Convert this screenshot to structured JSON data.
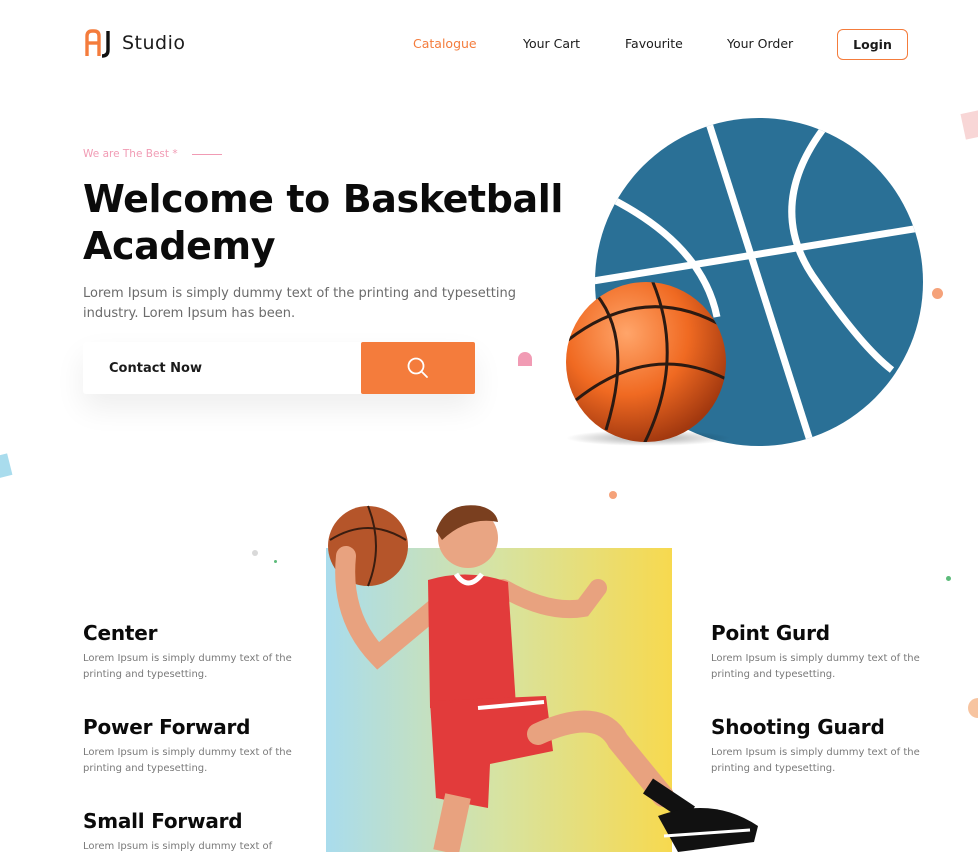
{
  "brand": {
    "mark": "AJ",
    "name": "Studio",
    "accent": "#f47c3c"
  },
  "nav": {
    "items": [
      {
        "label": "Catalogue",
        "active": true
      },
      {
        "label": "Your Cart",
        "active": false
      },
      {
        "label": "Favourite",
        "active": false
      },
      {
        "label": "Your Order",
        "active": false
      }
    ],
    "login_label": "Login"
  },
  "hero": {
    "tagline": "We are The Best *",
    "title": "Welcome to Basketball Academy",
    "description": "Lorem Ipsum is simply dummy text of the printing and typesetting industry. Lorem Ipsum has been.",
    "cta_label": "Contact Now",
    "cta_icon": "search-icon",
    "ball_color": "#2a7096"
  },
  "positions": {
    "left": [
      {
        "title": "Center",
        "desc": "Lorem Ipsum is simply dummy text of the printing and typesetting."
      },
      {
        "title": "Power Forward",
        "desc": "Lorem Ipsum is simply dummy text of the printing and typesetting."
      },
      {
        "title": "Small Forward",
        "desc": "Lorem Ipsum is simply dummy text of"
      }
    ],
    "right": [
      {
        "title": "Point Gurd",
        "desc": "Lorem Ipsum is simply dummy text of the printing and typesetting."
      },
      {
        "title": "Shooting Guard",
        "desc": "Lorem Ipsum is simply dummy text of the printing and typesetting."
      }
    ]
  },
  "colors": {
    "accent": "#f47c3c",
    "ball_blue": "#2a7096",
    "jersey_red": "#e23b3b",
    "pink": "#f19bb4"
  }
}
